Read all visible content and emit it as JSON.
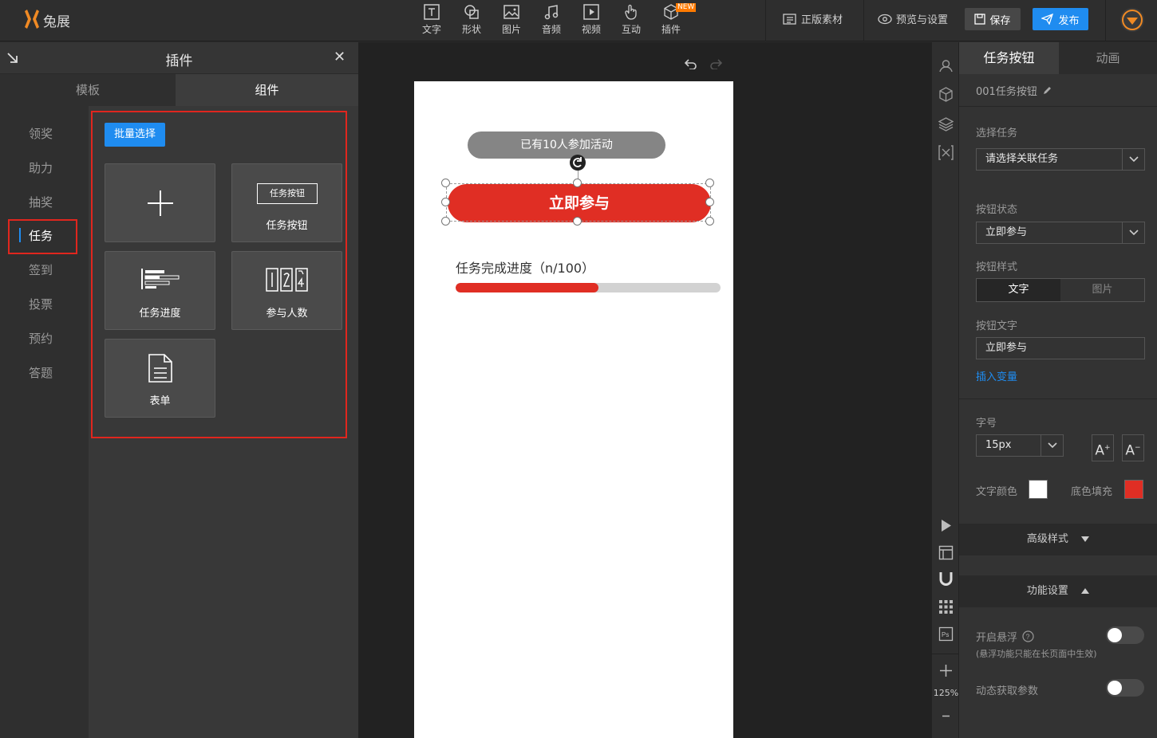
{
  "app": {
    "brand": "兔展"
  },
  "toolbar": {
    "tools": [
      {
        "label": "文字",
        "icon": "text-icon"
      },
      {
        "label": "形状",
        "icon": "shape-icon"
      },
      {
        "label": "图片",
        "icon": "image-icon"
      },
      {
        "label": "音频",
        "icon": "music-icon"
      },
      {
        "label": "视频",
        "icon": "video-icon"
      },
      {
        "label": "互动",
        "icon": "hand-icon"
      },
      {
        "label": "插件",
        "icon": "cube-icon",
        "badge": "NEW"
      }
    ],
    "assets_label": "正版素材",
    "preview_label": "预览与设置",
    "save_label": "保存",
    "publish_label": "发布"
  },
  "left_panel": {
    "title": "插件",
    "tabs": [
      "模板",
      "组件"
    ],
    "active_tab": "组件",
    "categories": [
      "领奖",
      "助力",
      "抽奖",
      "任务",
      "签到",
      "投票",
      "预约",
      "答题"
    ],
    "active_category": "任务",
    "batch_select_label": "批量选择",
    "components": [
      {
        "label": "",
        "icon": "plus-icon"
      },
      {
        "label": "任务按钮",
        "icon": "button-icon",
        "preview_text": "任务按钮"
      },
      {
        "label": "任务进度",
        "icon": "progress-icon"
      },
      {
        "label": "参与人数",
        "icon": "counter-icon",
        "preview_text": "12"
      },
      {
        "label": "表单",
        "icon": "form-icon"
      }
    ]
  },
  "canvas": {
    "participants_text": "已有10人参加活动",
    "task_button_text": "立即参与",
    "progress_label": "任务完成进度（n/100）",
    "progress_fraction": 0.54,
    "colors": {
      "button": "#e02e24",
      "pill": "#858585"
    }
  },
  "rail": {
    "zoom": "125%"
  },
  "props": {
    "tabs": [
      "任务按钮",
      "动画"
    ],
    "element_name": "001任务按钮",
    "select_task_label": "选择任务",
    "select_task_value": "请选择关联任务",
    "button_state_label": "按钮状态",
    "button_state_value": "立即参与",
    "button_style_label": "按钮样式",
    "style_options": [
      "文字",
      "图片"
    ],
    "button_text_label": "按钮文字",
    "button_text_value": "立即参与",
    "insert_variable_label": "插入变量",
    "font_size_label": "字号",
    "font_size_value": "15px",
    "font_inc_label": "A",
    "font_dec_label": "A",
    "text_color_label": "文字颜色",
    "text_color": "#ffffff",
    "fill_label": "底色填充",
    "fill_color": "#e02e24",
    "advanced_label": "高级样式",
    "function_label": "功能设置",
    "float_label": "开启悬浮",
    "float_note": "(悬浮功能只能在长页面中生效)",
    "dynamic_param_label": "动态获取参数"
  }
}
